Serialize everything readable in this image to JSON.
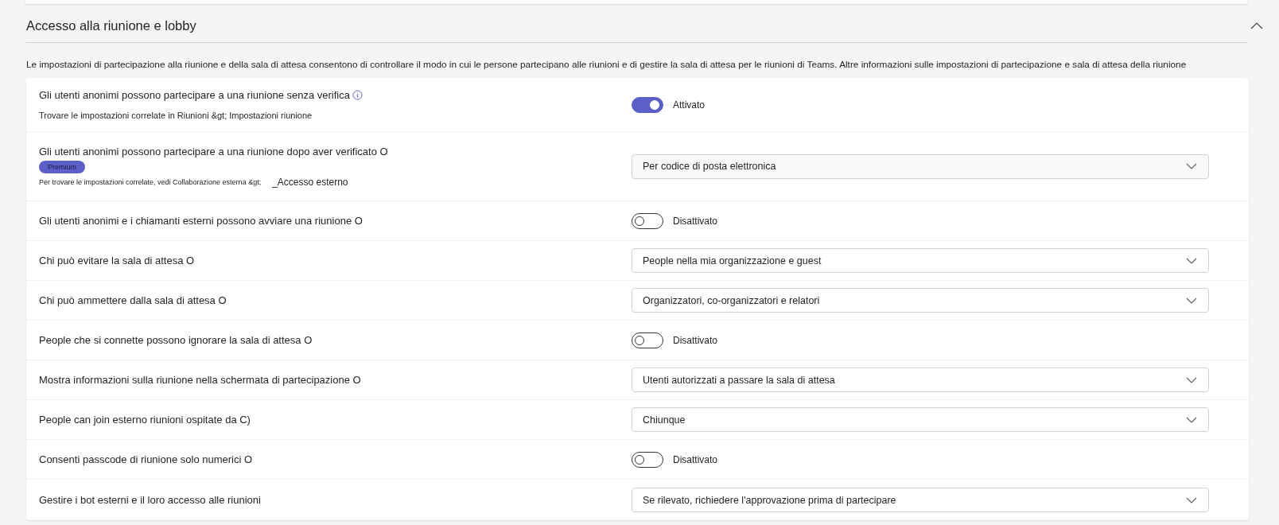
{
  "section": {
    "title": "Accesso alla riunione e lobby",
    "expanded": true,
    "description": "Le impostazioni di partecipazione alla riunione e della sala di attesa consentono di controllare il modo in cui le persone partecipano alle riunioni e di gestire la sala di attesa per le riunioni di Teams. Altre informazioni sulle impostazioni di partecipazione e sala di attesa della riunione",
    "rows": [
      {
        "kind": "toggle",
        "label": "Gli utenti anonimi possono partecipare a una riunione senza verifica",
        "info_icon": true,
        "related_text": "Trovare le impostazioni correlate in Riunioni &gt; Impostazioni riunione",
        "on": true,
        "state_text": "Attivato"
      },
      {
        "kind": "dropdown",
        "label": "Gli utenti anonimi possono partecipare a una riunione dopo aver verificato O",
        "badge": "Premium",
        "related_text": "Per trovare le impostazioni correlate, vedi Collaborazione esterna &gt;",
        "related_link": "_Accesso esterno",
        "value": "Per codice di posta elettronica"
      },
      {
        "kind": "toggle",
        "label": "Gli utenti anonimi e i chiamanti esterni possono avviare una riunione O",
        "on": false,
        "state_text": "Disattivato"
      },
      {
        "kind": "dropdown",
        "label": "Chi può evitare la sala di attesa O",
        "value": "People nella mia organizzazione e guest"
      },
      {
        "kind": "dropdown",
        "label": "Chi può ammettere dalla sala di attesa O",
        "value": "Organizzatori, co-organizzatori e relatori"
      },
      {
        "kind": "toggle",
        "label": "People che si connette possono ignorare la sala di attesa O",
        "on": false,
        "state_text": "Disattivato"
      },
      {
        "kind": "dropdown",
        "label": "Mostra informazioni sulla riunione nella schermata di partecipazione O",
        "value": "Utenti autorizzati a passare la sala di attesa"
      },
      {
        "kind": "dropdown",
        "label": "People can join esterno riunioni ospitate da C)",
        "value": "Chiunque"
      },
      {
        "kind": "toggle",
        "label": "Consenti passcode di riunione solo numerici O",
        "on": false,
        "state_text": "Disattivato"
      },
      {
        "kind": "dropdown",
        "label": "Gestire i bot esterni e il loro accesso alle riunioni",
        "value": "Se rilevato, richiedere l'approvazione prima di partecipare"
      }
    ]
  }
}
